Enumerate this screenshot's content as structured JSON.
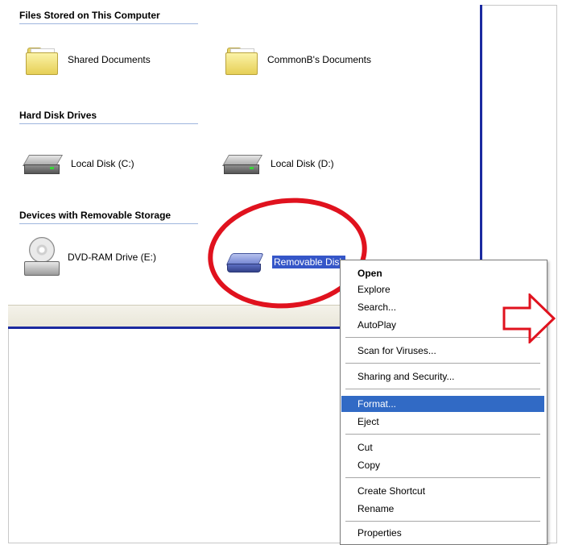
{
  "groups": {
    "files_stored": "Files Stored on This Computer",
    "hard_disk_drives": "Hard Disk Drives",
    "removable_storage": "Devices with Removable Storage"
  },
  "items": {
    "shared_documents": "Shared Documents",
    "common_documents": "CommonB's Documents",
    "local_disk_c": "Local Disk (C:)",
    "local_disk_d": "Local Disk (D:)",
    "dvd_ram": "DVD-RAM Drive (E:)",
    "removable_disk": "Removable Disk"
  },
  "context_menu": {
    "open": "Open",
    "explore": "Explore",
    "search": "Search...",
    "autoplay": "AutoPlay",
    "scan": "Scan for Viruses...",
    "sharing": "Sharing and Security...",
    "format": "Format...",
    "eject": "Eject",
    "cut": "Cut",
    "copy": "Copy",
    "create_shortcut": "Create Shortcut",
    "rename": "Rename",
    "properties": "Properties"
  },
  "colors": {
    "highlight_circle": "#e0121e",
    "selection": "#3556c8",
    "menu_hover": "#316ac5",
    "divider_blue": "#1b2aa0"
  }
}
